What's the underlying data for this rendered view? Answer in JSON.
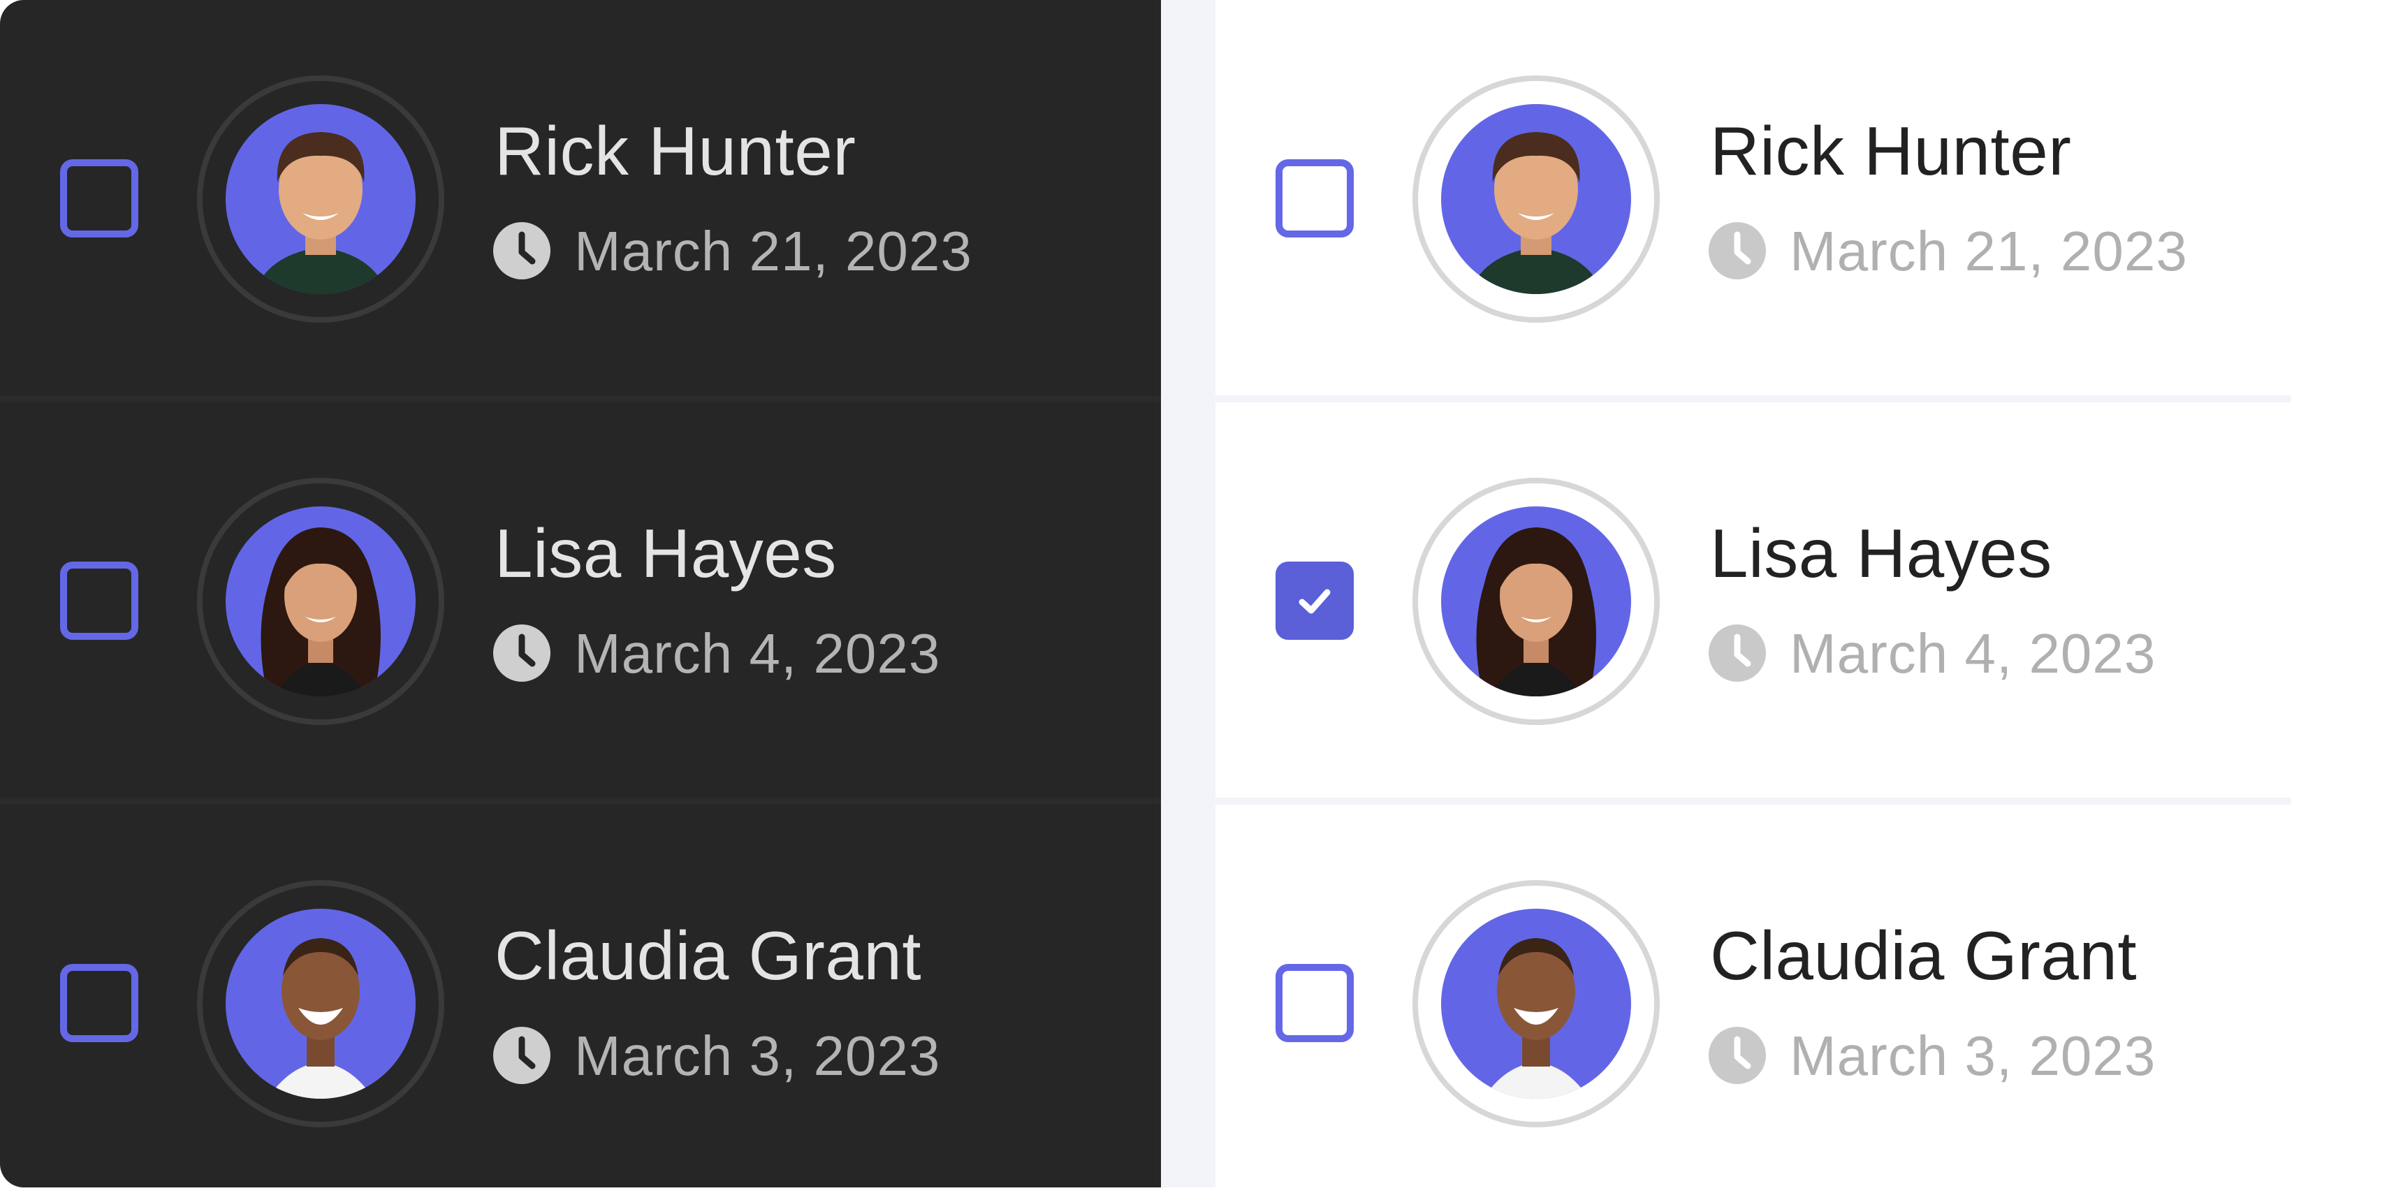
{
  "theme_colors": {
    "accent": "#5b5fd8",
    "avatar_background": "#6266e6",
    "dark_background": "#262626",
    "light_background": "#ffffff"
  },
  "icons": {
    "clock": "clock-icon",
    "check": "checkmark-icon"
  },
  "dark_list": {
    "items": [
      {
        "name": "Rick Hunter",
        "date": "March 21, 2023",
        "checked": false
      },
      {
        "name": "Lisa Hayes",
        "date": "March 4, 2023",
        "checked": false
      },
      {
        "name": "Claudia Grant",
        "date": "March 3, 2023",
        "checked": false
      }
    ]
  },
  "light_list": {
    "items": [
      {
        "name": "Rick Hunter",
        "date": "March 21, 2023",
        "checked": false
      },
      {
        "name": "Lisa Hayes",
        "date": "March 4, 2023",
        "checked": true
      },
      {
        "name": "Claudia Grant",
        "date": "March 3, 2023",
        "checked": false
      }
    ]
  }
}
